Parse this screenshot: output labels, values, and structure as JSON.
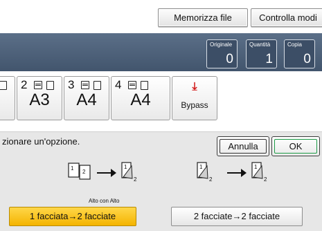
{
  "toolbar": {
    "store_file_label": "Memorizza file",
    "check_modes_label": "Controlla modi"
  },
  "counters": [
    {
      "label": "Originale",
      "value": "0"
    },
    {
      "label": "Quantità",
      "value": "1"
    },
    {
      "label": "Copia",
      "value": "0"
    }
  ],
  "trays": [
    {
      "number": "2",
      "size": "A3"
    },
    {
      "number": "3",
      "size": "A4"
    },
    {
      "number": "4",
      "size": "A4"
    }
  ],
  "bypass": {
    "label": "Bypass"
  },
  "dialog": {
    "prompt": "zionare un'opzione.",
    "cancel_label": "Annulla",
    "ok_label": "OK"
  },
  "options": {
    "left_caption": "Alto con Alto",
    "left_label": "1 facciata→2 facciate",
    "right_label": "2 facciate→2 facciate"
  },
  "colors": {
    "band": "#4a5d76",
    "selected": "#f7be0c",
    "ok_border": "#1b9a45",
    "bypass_arrow": "#d21a1a"
  }
}
